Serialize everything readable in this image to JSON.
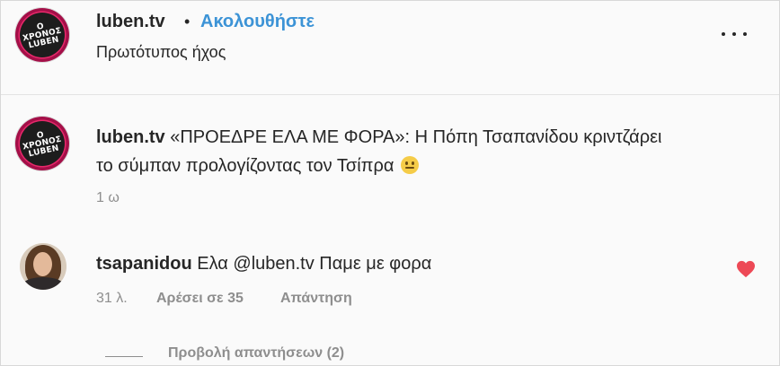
{
  "header": {
    "username": "luben.tv",
    "separator": "•",
    "follow_label": "Ακολουθήστε",
    "audio_label": "Πρωτότυπος ήχος",
    "avatar_logo_text": "Ο ΧΡΟΝΟΣ LUBEN",
    "more_icon": "more-horizontal-icon"
  },
  "caption": {
    "username": "luben.tv",
    "text": "«ΠΡΟΕΔΡΕ ΕΛΑ ΜΕ ΦΟΡΑ»: Η Πόπη Τσαπανίδου κριντζάρει το σύμπαν προλογίζοντας τον Τσίπρα",
    "emoji": "grimace-face-emoji",
    "time": "1 ω"
  },
  "comment": {
    "username": "tsapanidou",
    "text": "Ελα @luben.tv Παμε με φορα",
    "time": "31 λ.",
    "likes": "Αρέσει σε 35",
    "reply_label": "Απάντηση",
    "like_icon": "heart-icon",
    "like_color": "#ed4956"
  },
  "view_replies": "Προβολή απαντήσεων (2)",
  "colors": {
    "accent": "#3c93d6",
    "muted": "#8e8e8e",
    "text": "#262626"
  }
}
